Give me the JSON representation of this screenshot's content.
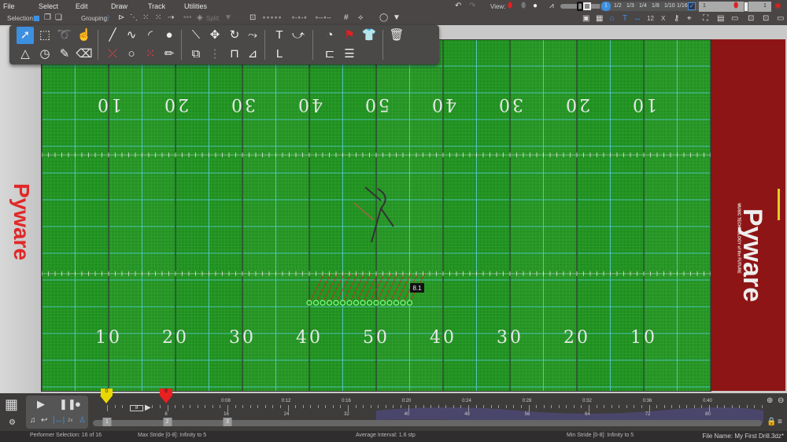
{
  "menu": [
    "File",
    "Select",
    "Edit",
    "Draw",
    "Track",
    "Utilities"
  ],
  "options": {
    "selection_label": "Selection:",
    "grouping_label": "Grouping:",
    "split_label": "Split:"
  },
  "view": {
    "label": "View:",
    "fractions": [
      "1",
      "1/2",
      "1/3",
      "1/4",
      "1/8",
      "1/10",
      "1/16"
    ],
    "page_start": "1",
    "page_end": "1",
    "grid_number": "12",
    "x_label": "X"
  },
  "field": {
    "yard_numbers": [
      "10",
      "20",
      "30",
      "40",
      "50",
      "40",
      "30",
      "20",
      "10"
    ],
    "performer_count": 16,
    "set_label": "8.1",
    "turf_color": "#1f8f1f",
    "band_color": "#8e1515"
  },
  "brand": {
    "name": "Pyware",
    "tagline": "MUSIC TECHNOLOGY of the FUTURE"
  },
  "timeline": {
    "start_marker": "0",
    "end_marker": "8",
    "counts_box": "8",
    "times": [
      "0:08",
      "0:12",
      "0:16",
      "0:20",
      "0:24",
      "0:28",
      "0:32",
      "0:36",
      "0:40"
    ],
    "counts": [
      "8",
      "16",
      "24",
      "32",
      "40",
      "48",
      "56",
      "64",
      "72",
      "80"
    ],
    "pages": [
      "1",
      "2",
      "3"
    ],
    "speed": "2x"
  },
  "status": {
    "selection": "Performer Selection: 16 of 16",
    "max_stride": "Max Stride [0-8]: Infinity to 5",
    "avg_interval": "Average Interval: 1.6 stp",
    "min_stride": "Min Stride [0-8]: Infinity to 5",
    "file_name": "File Name: My First Drill.3dz*"
  }
}
